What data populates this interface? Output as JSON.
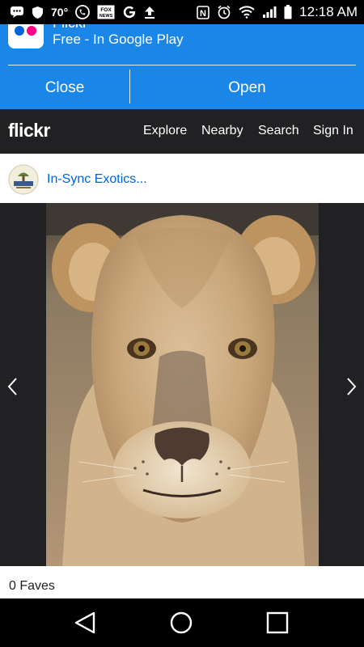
{
  "status_bar": {
    "temperature": "70°",
    "news_label": "FOX NEWS",
    "clock": "12:18 AM",
    "icons": [
      "messenger-icon",
      "shield-icon",
      "phone-icon",
      "news-icon",
      "google-icon",
      "upload-icon",
      "nfc-icon",
      "alarm-icon",
      "wifi-icon",
      "signal-icon",
      "battery-icon"
    ]
  },
  "banner": {
    "app_name": "Flickr",
    "subtitle": "Free - In Google Play",
    "close_label": "Close",
    "open_label": "Open",
    "color": "#1a87e8"
  },
  "navbar": {
    "logo": "flickr",
    "links": [
      "Explore",
      "Nearby",
      "Search",
      "Sign In"
    ],
    "background": "#212124"
  },
  "owner": {
    "name": "In-Sync Exotics...",
    "link_color": "#0063dc"
  },
  "photo": {
    "subject": "lioness"
  },
  "faves": {
    "label": "0 Faves"
  },
  "android_nav": {
    "icons": [
      "back-icon",
      "home-icon",
      "recents-icon"
    ]
  }
}
